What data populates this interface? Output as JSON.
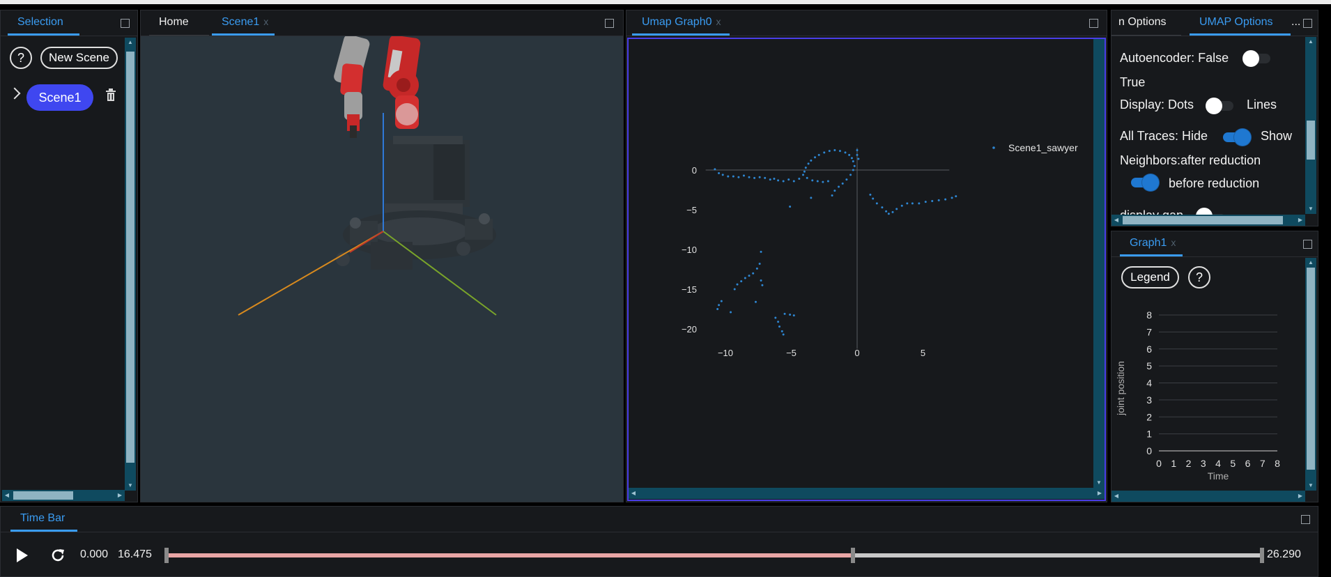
{
  "selection_panel": {
    "tab_label": "Selection",
    "help_label": "?",
    "new_scene_label": "New Scene",
    "scene_item_label": "Scene1"
  },
  "scene_panel": {
    "tab_home": "Home",
    "tab_scene": "Scene1",
    "tab_close": "x"
  },
  "umap_panel": {
    "tab_label": "Umap Graph0",
    "tab_close": "x",
    "legend_label": "Scene1_sawyer",
    "marker_color": "#2e86d1",
    "chart_data": {
      "type": "scatter",
      "title": "",
      "xlabel": "",
      "ylabel": "",
      "x_ticks": [
        "−10",
        "−5",
        "0",
        "5"
      ],
      "y_ticks": [
        "0",
        "−5",
        "−10",
        "−15",
        "−20"
      ],
      "series": [
        {
          "name": "Scene1_sawyer",
          "points": [
            [
              -10.8,
              0.1
            ],
            [
              -10.5,
              -0.4
            ],
            [
              -10.2,
              -0.6
            ],
            [
              -9.8,
              -0.8
            ],
            [
              -9.4,
              -0.8
            ],
            [
              -9.0,
              -0.9
            ],
            [
              -8.6,
              -0.7
            ],
            [
              -8.2,
              -0.9
            ],
            [
              -7.8,
              -1.0
            ],
            [
              -7.4,
              -0.9
            ],
            [
              -7.0,
              -1.0
            ],
            [
              -6.6,
              -1.2
            ],
            [
              -6.3,
              -1.1
            ],
            [
              -6.0,
              -1.3
            ],
            [
              -5.6,
              -1.4
            ],
            [
              -5.2,
              -1.2
            ],
            [
              -4.8,
              -1.4
            ],
            [
              -4.4,
              -1.1
            ],
            [
              -4.1,
              -0.6
            ],
            [
              -4.0,
              -0.2
            ],
            [
              -3.9,
              0.3
            ],
            [
              -3.7,
              0.8
            ],
            [
              -3.5,
              1.2
            ],
            [
              -3.2,
              1.6
            ],
            [
              -2.9,
              1.9
            ],
            [
              -2.5,
              2.2
            ],
            [
              -2.1,
              2.4
            ],
            [
              -1.7,
              2.5
            ],
            [
              -1.3,
              2.4
            ],
            [
              -0.9,
              2.2
            ],
            [
              -0.6,
              1.9
            ],
            [
              -0.4,
              1.5
            ],
            [
              -0.3,
              1.1
            ],
            [
              -0.2,
              0.5
            ],
            [
              -0.3,
              0.0
            ],
            [
              -0.5,
              -0.6
            ],
            [
              -0.8,
              -1.2
            ],
            [
              -1.1,
              -1.7
            ],
            [
              -1.4,
              -2.1
            ],
            [
              -1.7,
              -2.6
            ],
            [
              -1.9,
              -3.2
            ],
            [
              0.0,
              2.5
            ],
            [
              0.0,
              1.9
            ],
            [
              0.1,
              1.4
            ],
            [
              -3.8,
              -1.0
            ],
            [
              -3.4,
              -1.3
            ],
            [
              -3.0,
              -1.4
            ],
            [
              -2.6,
              -1.5
            ],
            [
              -2.2,
              -1.4
            ],
            [
              1.0,
              -3.1
            ],
            [
              1.2,
              -3.6
            ],
            [
              1.5,
              -4.2
            ],
            [
              1.9,
              -4.7
            ],
            [
              2.2,
              -5.2
            ],
            [
              2.4,
              -5.5
            ],
            [
              2.7,
              -5.3
            ],
            [
              3.0,
              -4.9
            ],
            [
              3.4,
              -4.5
            ],
            [
              3.8,
              -4.2
            ],
            [
              4.2,
              -4.2
            ],
            [
              4.7,
              -4.2
            ],
            [
              5.2,
              -4.0
            ],
            [
              5.7,
              -3.9
            ],
            [
              6.2,
              -3.8
            ],
            [
              6.7,
              -3.7
            ],
            [
              7.2,
              -3.5
            ],
            [
              7.5,
              -3.3
            ],
            [
              -5.1,
              -4.6
            ],
            [
              -3.5,
              -3.5
            ],
            [
              -7.3,
              -10.3
            ],
            [
              -7.4,
              -11.8
            ],
            [
              -7.6,
              -12.4
            ],
            [
              -7.9,
              -13.0
            ],
            [
              -8.2,
              -13.3
            ],
            [
              -8.5,
              -13.6
            ],
            [
              -8.8,
              -14.0
            ],
            [
              -9.1,
              -14.4
            ],
            [
              -9.3,
              -15.0
            ],
            [
              -7.3,
              -13.9
            ],
            [
              -7.2,
              -14.5
            ],
            [
              -10.3,
              -16.5
            ],
            [
              -10.5,
              -17.0
            ],
            [
              -10.6,
              -17.5
            ],
            [
              -9.6,
              -17.9
            ],
            [
              -7.7,
              -16.6
            ],
            [
              -6.2,
              -18.6
            ],
            [
              -6.0,
              -19.1
            ],
            [
              -5.9,
              -19.7
            ],
            [
              -5.7,
              -20.3
            ],
            [
              -5.6,
              -20.7
            ],
            [
              -5.5,
              -18.1
            ],
            [
              -5.1,
              -18.2
            ],
            [
              -4.8,
              -18.3
            ]
          ]
        }
      ]
    }
  },
  "umap_options_panel": {
    "tab_left": "n Options",
    "tab_active": "UMAP Options",
    "tab_more": "...",
    "autoencoder_label": "Autoencoder: False",
    "autoencoder_true": "True",
    "display_label": "Display: Dots",
    "display_alt": "Lines",
    "traces_label": "All Traces: Hide",
    "traces_alt": "Show",
    "neighbors_label": "Neighbors:after reduction",
    "neighbors_alt": "before reduction",
    "display_gap_label": "display gap",
    "toggle_on_color": "#1f78d1"
  },
  "graph1_panel": {
    "tab_label": "Graph1",
    "tab_close": "x",
    "legend_label": "Legend",
    "help_label": "?",
    "chart_data": {
      "type": "line",
      "title": "",
      "xlabel": "Time",
      "ylabel": "joint position",
      "x_ticks": [
        "0",
        "1",
        "2",
        "3",
        "4",
        "5",
        "6",
        "7",
        "8"
      ],
      "y_ticks": [
        "0",
        "1",
        "2",
        "3",
        "4",
        "5",
        "6",
        "7",
        "8"
      ],
      "xlim": [
        0,
        8
      ],
      "ylim": [
        0,
        8
      ],
      "grid": true,
      "series": []
    }
  },
  "time_bar": {
    "tab_label": "Time Bar",
    "start_time": "0.000",
    "current_time": "16.475",
    "end_time": "26.290",
    "progress_fraction": 0.6267,
    "played_color": "#e9a6a6",
    "remaining_color": "#c8c8c8"
  }
}
